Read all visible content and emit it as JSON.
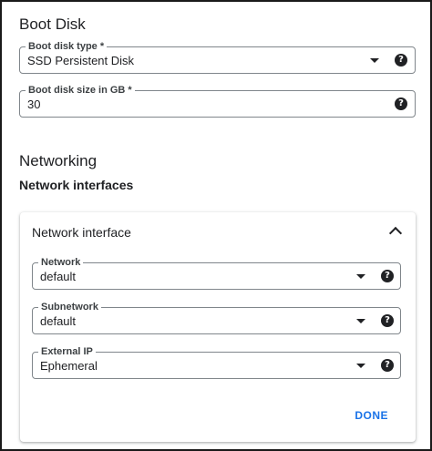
{
  "boot_disk": {
    "heading": "Boot Disk",
    "type_field": {
      "label": "Boot disk type *",
      "value": "SSD Persistent Disk"
    },
    "size_field": {
      "label": "Boot disk size in GB *",
      "value": "30"
    }
  },
  "networking": {
    "heading": "Networking",
    "subheading": "Network interfaces",
    "card": {
      "title": "Network interface",
      "network": {
        "label": "Network",
        "value": "default"
      },
      "subnetwork": {
        "label": "Subnetwork",
        "value": "default"
      },
      "external_ip": {
        "label": "External IP",
        "value": "Ephemeral"
      },
      "done_label": "DONE"
    }
  },
  "icons": {
    "help": "?",
    "dropdown": "caret-down-icon",
    "collapse": "chevron-up-icon"
  },
  "colors": {
    "accent": "#1a73e8",
    "text": "#202124",
    "border": "#80868b"
  }
}
